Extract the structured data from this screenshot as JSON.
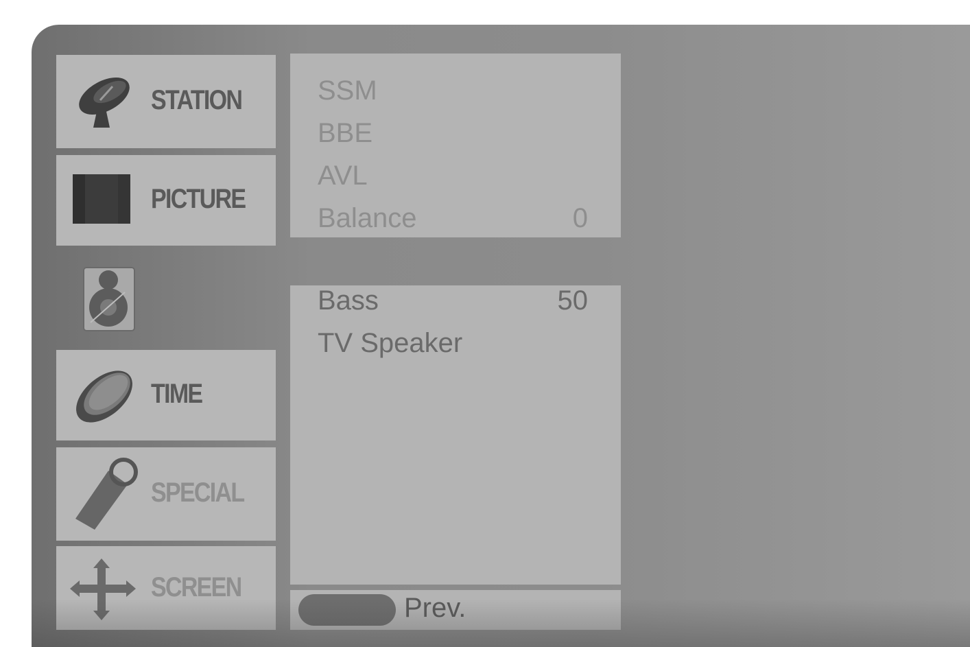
{
  "sidebar": {
    "items": [
      {
        "label": "STATION",
        "icon": "satellite-dish-icon"
      },
      {
        "label": "PICTURE",
        "icon": "tv-screen-icon"
      },
      {
        "label": "",
        "icon": "speaker-icon"
      },
      {
        "label": "TIME",
        "icon": "clock-icon"
      },
      {
        "label": "SPECIAL",
        "icon": "tag-icon"
      },
      {
        "label": "SCREEN",
        "icon": "move-arrows-icon"
      }
    ]
  },
  "audio_menu": {
    "group1": [
      {
        "label": "SSM",
        "value": ""
      },
      {
        "label": "BBE",
        "value": ""
      },
      {
        "label": "AVL",
        "value": ""
      },
      {
        "label": "Balance",
        "value": "0"
      }
    ],
    "group2": [
      {
        "label": "Bass",
        "value": "50"
      },
      {
        "label": "TV Speaker",
        "value": ""
      }
    ]
  },
  "footer": {
    "prev_label": "Prev."
  },
  "colors": {
    "tile": "#b7b7b7",
    "panel": "#b4b4b4",
    "background": "#8a8a8a",
    "text": "#8e8e8e"
  }
}
